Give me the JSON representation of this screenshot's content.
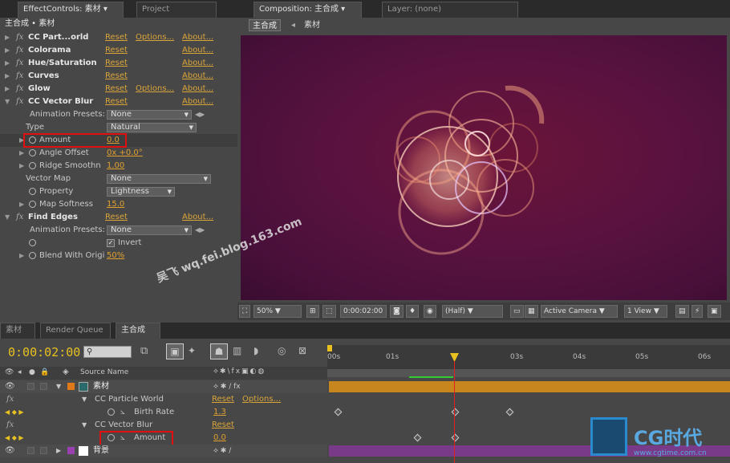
{
  "left_tabs": {
    "effect_controls": "EffectControls: 素材",
    "project": "Project"
  },
  "breadcrumb": "主合成 • 素材",
  "effects": [
    {
      "name": "CC Part...orld",
      "reset": "Reset",
      "options": "Options...",
      "about": "About..."
    },
    {
      "name": "Colorama",
      "reset": "Reset",
      "about": "About..."
    },
    {
      "name": "Hue/Saturation",
      "reset": "Reset",
      "about": "About..."
    },
    {
      "name": "Curves",
      "reset": "Reset",
      "about": "About..."
    },
    {
      "name": "Glow",
      "reset": "Reset",
      "options": "Options...",
      "about": "About..."
    },
    {
      "name": "CC Vector Blur",
      "reset": "Reset",
      "about": "About..."
    }
  ],
  "vector_blur": {
    "animation_presets_label": "Animation Presets:",
    "animation_presets_value": "None",
    "type_label": "Type",
    "type_value": "Natural",
    "amount_label": "Amount",
    "amount_value": "0.0",
    "angle_label": "Angle Offset",
    "angle_value": "0x +0.0°",
    "ridge_label": "Ridge Smoothn",
    "ridge_value": "1.00",
    "vector_map_label": "Vector Map",
    "vector_map_value": "None",
    "property_label": "Property",
    "property_value": "Lightness",
    "map_softness_label": "Map Softness",
    "map_softness_value": "15.0"
  },
  "find_edges": {
    "name": "Find Edges",
    "reset": "Reset",
    "about": "About...",
    "animation_presets_label": "Animation Presets:",
    "animation_presets_value": "None",
    "invert_label": "Invert",
    "blend_label": "Blend With Origi",
    "blend_value": "50%"
  },
  "comp_tabs": {
    "composition": "Composition: 主合成",
    "layer": "Layer: (none)"
  },
  "comp_crumbs": {
    "comp": "主合成",
    "layer": "素材"
  },
  "viewer_bar": {
    "zoom": "50%",
    "timecode": "0:00:02:00",
    "resolution": "(Half)",
    "camera": "Active Camera",
    "views": "1 View"
  },
  "timeline_tabs": {
    "t1": "素材",
    "t2": "Render Queue",
    "t3": "主合成"
  },
  "timeline": {
    "timecode": "0:00:02:00",
    "source_name_header": "Source Name",
    "ticks": [
      "00s",
      "01s",
      "03s",
      "04s",
      "05s",
      "06s"
    ],
    "layers": [
      {
        "name": "素材"
      },
      {
        "name": "CC Particle World",
        "reset": "Reset",
        "options": "Options..."
      },
      {
        "name": "Birth Rate",
        "value": "1.3"
      },
      {
        "name": "CC Vector Blur",
        "reset": "Reset"
      },
      {
        "name": "Amount",
        "value": "0.0"
      },
      {
        "name": "背景"
      }
    ]
  },
  "watermark": {
    "text": "吴飞 wq.fei.blog.163.com",
    "logo": "CG时代",
    "url": "www.cgtime.com.cn"
  },
  "colors": {
    "accent_orange": "#d9a53a",
    "highlight_red": "#e01010",
    "timecode_yellow": "#e8c020"
  }
}
